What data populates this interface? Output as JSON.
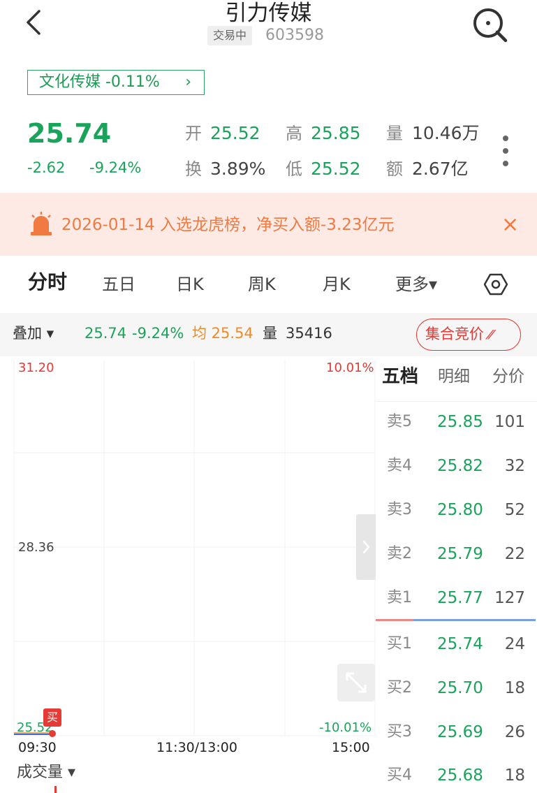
{
  "header": {
    "title": "引力传媒",
    "status": "交易中",
    "code": "603598"
  },
  "sector": {
    "label": "文化传媒 -0.11%"
  },
  "quote": {
    "price": "25.74",
    "change": "-2.62",
    "change_pct": "-9.24%",
    "open_label": "开",
    "open": "25.52",
    "high_label": "高",
    "high": "25.85",
    "volume_label": "量",
    "volume": "10.46万",
    "turnover_label": "换",
    "turnover": "3.89%",
    "low_label": "低",
    "low": "25.52",
    "amount_label": "额",
    "amount": "2.67亿"
  },
  "alert": {
    "text": "2026-01-14 入选龙虎榜，净买入额-3.23亿元",
    "close": "×"
  },
  "tabs": [
    {
      "label": "分时"
    },
    {
      "label": "五日"
    },
    {
      "label": "日K"
    },
    {
      "label": "周K"
    },
    {
      "label": "月K"
    },
    {
      "label": "更多▾"
    }
  ],
  "overlay": {
    "label": "叠加 ▾",
    "price": "25.74",
    "pct": "-9.24%",
    "avg": "均 25.54",
    "vol_label": "量",
    "vol": "35416",
    "auction": "集合竞价"
  },
  "chart": {
    "top_left": "31.20",
    "top_right": "10.01%",
    "mid_left": "28.36",
    "bottom_left": "25.52",
    "bottom_right": "-10.01%",
    "time_start": "09:30",
    "time_mid": "11:30/13:00",
    "time_end": "15:00",
    "buy_marker": "买",
    "volume_label": "成交量 ▾"
  },
  "orderbook": {
    "tabs": [
      {
        "label": "五档"
      },
      {
        "label": "明细"
      },
      {
        "label": "分价"
      }
    ],
    "asks": [
      {
        "label": "卖5",
        "price": "25.85",
        "vol": "101"
      },
      {
        "label": "卖4",
        "price": "25.82",
        "vol": "32"
      },
      {
        "label": "卖3",
        "price": "25.80",
        "vol": "52"
      },
      {
        "label": "卖2",
        "price": "25.79",
        "vol": "22"
      },
      {
        "label": "卖1",
        "price": "25.77",
        "vol": "127"
      }
    ],
    "bids": [
      {
        "label": "买1",
        "price": "25.74",
        "vol": "24"
      },
      {
        "label": "买2",
        "price": "25.70",
        "vol": "18"
      },
      {
        "label": "买3",
        "price": "25.69",
        "vol": "26"
      },
      {
        "label": "买4",
        "price": "25.68",
        "vol": "18"
      }
    ]
  },
  "colors": {
    "up": "#e53a35",
    "down": "#1aa35a",
    "alert": "#f07a42",
    "avg": "#f08a24"
  }
}
